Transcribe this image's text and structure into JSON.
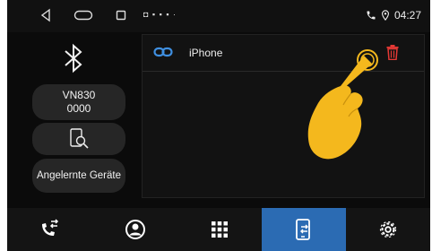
{
  "statusbar": {
    "time": "04:27",
    "notification_icons": "◘ ▪ ▪ ▪ ·"
  },
  "left": {
    "device_name": "VN830",
    "device_pin": "0000",
    "paired_devices_label": "Angelernte Geräte"
  },
  "device_list": [
    {
      "name": "iPhone"
    }
  ],
  "bottom_tabs": [
    {
      "name": "calls",
      "icon": "phone-transfer-icon"
    },
    {
      "name": "contacts",
      "icon": "person-icon"
    },
    {
      "name": "keypad",
      "icon": "dialpad-icon"
    },
    {
      "name": "devices",
      "icon": "phone-swap-icon",
      "active": true
    },
    {
      "name": "settings",
      "icon": "gear-icon"
    }
  ],
  "colors": {
    "accent": "#2b6bb3",
    "link": "#3f8fe0",
    "delete": "#e53935",
    "hand": "#f4b81d"
  }
}
